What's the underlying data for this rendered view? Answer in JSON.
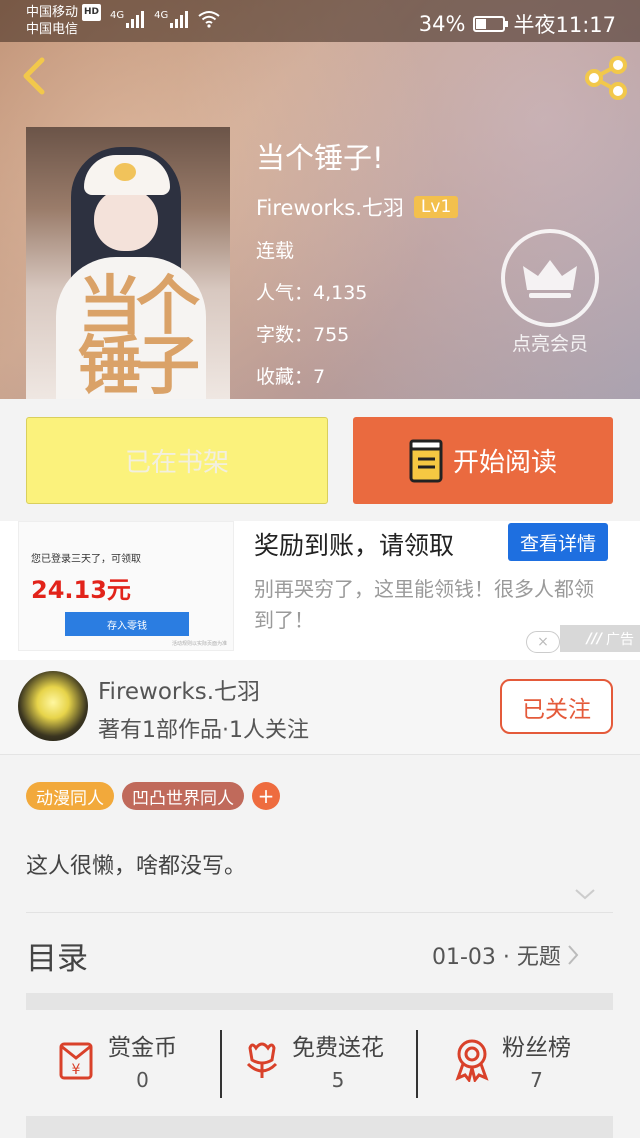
{
  "status_bar": {
    "carrier1": "中国移动",
    "carrier2": "中国电信",
    "hd": "HD",
    "net1": "4G",
    "net2": "4G",
    "battery": "34%",
    "time": "半夜11:17"
  },
  "book": {
    "title": "当个锤子!",
    "cover_title": "当个锤子",
    "author": "Fireworks.七羽",
    "level": "Lv1",
    "status": "连载",
    "popularity": "人气：4,135",
    "words": "字数：755",
    "favorites": "收藏：7"
  },
  "vip": {
    "label": "点亮会员"
  },
  "buttons": {
    "shelf": "已在书架",
    "read": "开始阅读"
  },
  "ad": {
    "img_line1": "您已登录三天了，可领取",
    "img_amount": "24.13元",
    "img_button": "存入零钱",
    "img_fine": "活动规则以实际页面为准",
    "title": "奖励到账，请领取",
    "cta": "查看详情",
    "desc": "别再哭穷了，这里能领钱！很多人都领到了！",
    "close": "×",
    "tag": "广告"
  },
  "author_card": {
    "name": "Fireworks.七羽",
    "stats": "著有1部作品·1人关注",
    "follow": "已关注"
  },
  "tags": [
    "动漫同人",
    "凹凸世界同人"
  ],
  "tag_add": "+",
  "bio": "这人很懒，啥都没写。",
  "toc": {
    "title": "目录",
    "latest": "01-03 · 无题"
  },
  "actions": [
    {
      "label": "赏金币",
      "count": "0",
      "icon": "coin-envelope-icon"
    },
    {
      "label": "免费送花",
      "count": "5",
      "icon": "flower-icon"
    },
    {
      "label": "粉丝榜",
      "count": "7",
      "icon": "medal-icon"
    }
  ],
  "colors": {
    "accent": "#ea6a3f",
    "shelf": "#fbf27c",
    "ad_blue": "#1e6fe0",
    "tag_orange": "#f2a93b",
    "tag_brown": "#c06a5b",
    "icon_red": "#d9412a"
  }
}
